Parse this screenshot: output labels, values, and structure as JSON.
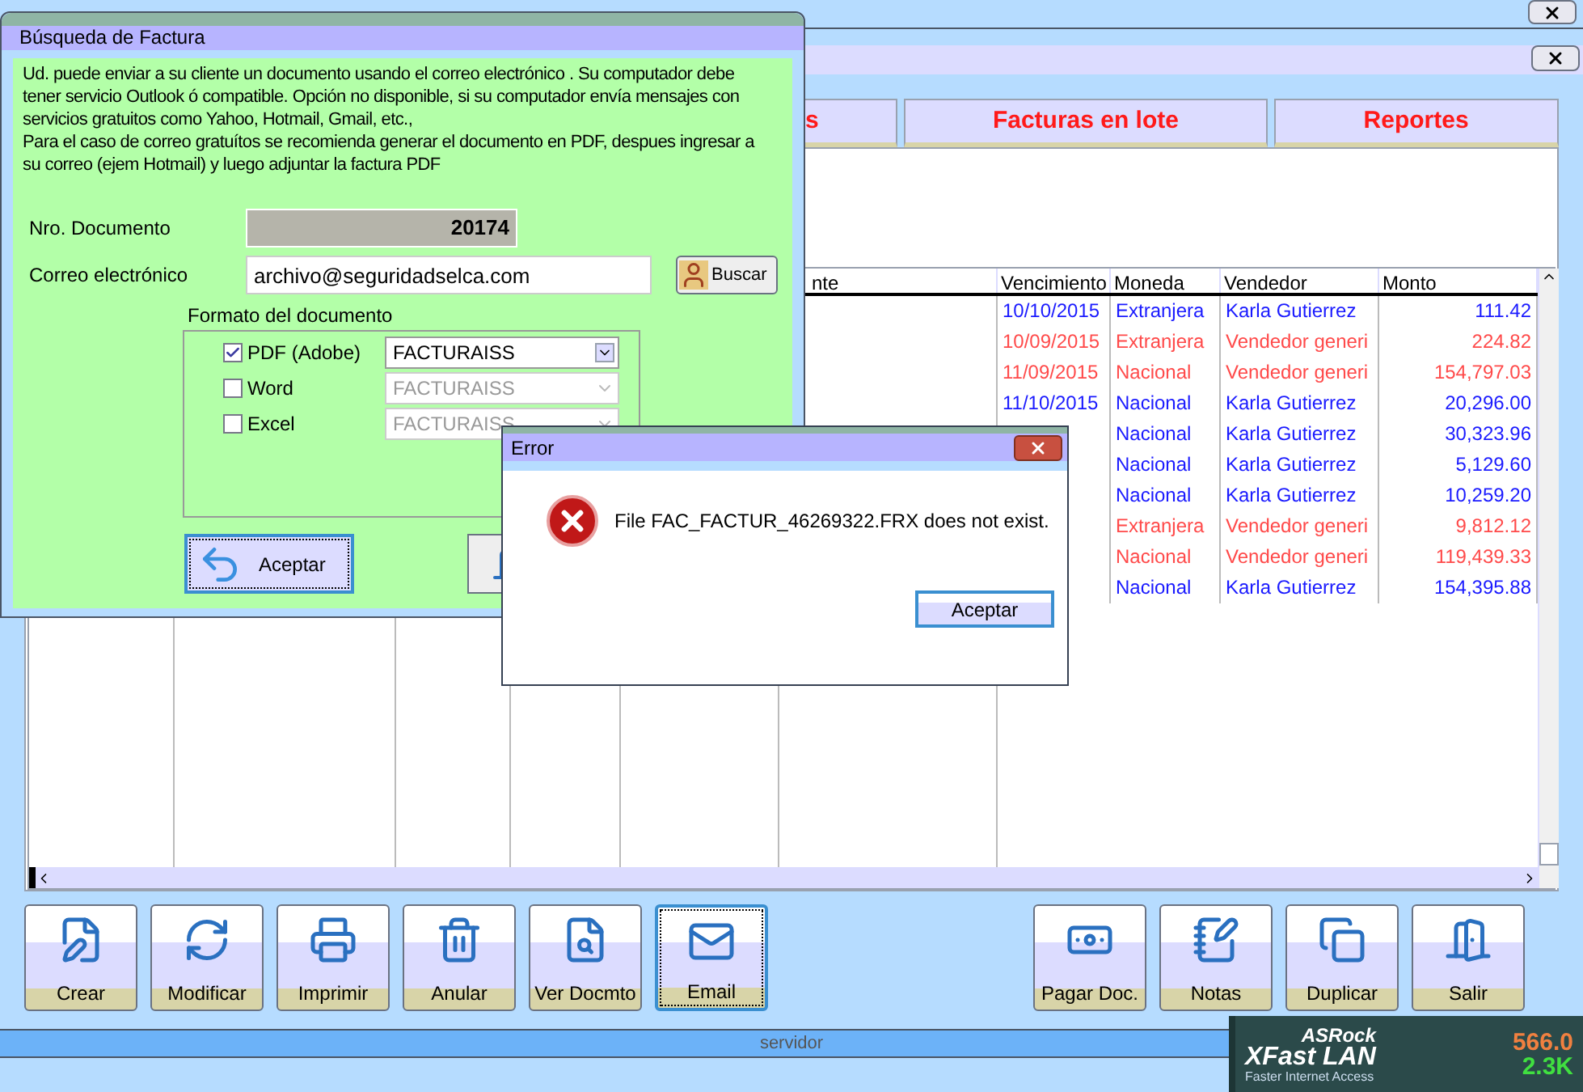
{
  "tabs": [
    {
      "label": "s",
      "selected": false
    },
    {
      "label": "Facturas en lote",
      "selected": false
    },
    {
      "label": "Reportes",
      "selected": false
    }
  ],
  "table": {
    "columns": [
      "nte",
      "Vencimiento",
      "Moneda",
      "Vendedor",
      "Monto"
    ],
    "rows": [
      {
        "color": "#1a1aff",
        "vencimiento": "10/10/2015",
        "moneda": "Extranjera",
        "vendedor": "Karla Gutierrez",
        "monto": "111.42"
      },
      {
        "color": "#ff4a4a",
        "vencimiento": "10/09/2015",
        "moneda": "Extranjera",
        "vendedor": "Vendedor generi",
        "monto": "224.82"
      },
      {
        "color": "#ff4a4a",
        "vencimiento": "11/09/2015",
        "moneda": "Nacional",
        "vendedor": "Vendedor generi",
        "monto": "154,797.03"
      },
      {
        "color": "#1a1aff",
        "vencimiento": "11/10/2015",
        "moneda": "Nacional",
        "vendedor": "Karla Gutierrez",
        "monto": "20,296.00"
      },
      {
        "color": "#1a1aff",
        "moneda": "Nacional",
        "vendedor": "Karla Gutierrez",
        "monto": "30,323.96"
      },
      {
        "color": "#1a1aff",
        "moneda": "Nacional",
        "vendedor": "Karla Gutierrez",
        "monto": "5,129.60"
      },
      {
        "color": "#1a1aff",
        "moneda": "Nacional",
        "vendedor": "Karla Gutierrez",
        "monto": "10,259.20"
      },
      {
        "color": "#ff4a4a",
        "moneda": "Extranjera",
        "vendedor": "Vendedor generi",
        "monto": "9,812.12"
      },
      {
        "color": "#ff4a4a",
        "moneda": "Nacional",
        "vendedor": "Vendedor generi",
        "monto": "119,439.33"
      },
      {
        "color": "#1a1aff",
        "moneda": "Nacional",
        "vendedor": "Karla Gutierrez",
        "monto": "154,395.88"
      }
    ]
  },
  "toolbar": [
    {
      "label": "Crear",
      "selected": false
    },
    {
      "label": "Modificar",
      "selected": false
    },
    {
      "label": "Imprimir",
      "selected": false
    },
    {
      "label": "Anular",
      "selected": false
    },
    {
      "label": "Ver Docmto",
      "selected": false
    },
    {
      "label": "Email",
      "selected": true
    },
    {
      "label": "Pagar Doc.",
      "selected": false
    },
    {
      "label": "Notas",
      "selected": false
    },
    {
      "label": "Duplicar",
      "selected": false
    },
    {
      "label": "Salir",
      "selected": false
    }
  ],
  "status_bar": {
    "text": "servidor"
  },
  "widget": {
    "brand": "ASRock",
    "product": "XFast LAN",
    "tagline": "Faster Internet Access",
    "readings": [
      "566.0",
      "2.3K"
    ]
  },
  "search_dialog": {
    "title": "Búsqueda de Factura",
    "info": "Ud. puede enviar a su cliente un documento usando el correo electrónico . Su computador debe tener servicio Outlook ó compatible.  Opción no disponible, si su computador envía mensajes  con servicios gratuitos como Yahoo, Hotmail,  Gmail, etc.,\nPara el caso de correo gratuítos se recomienda generar el documento en PDF, despues ingresar a su correo (ejem Hotmail) y luego adjuntar la factura PDF",
    "doc_label": "Nro. Documento",
    "doc_value": "20174",
    "email_label": "Correo electrónico",
    "email_value": "archivo@seguridadselca.com",
    "search_button": "Buscar",
    "format_title": "Formato del documento",
    "formats": [
      {
        "label": "PDF (Adobe)",
        "checked": true,
        "template": "FACTURAISS",
        "disabled": false
      },
      {
        "label": "Word",
        "checked": false,
        "template": "FACTURAISS",
        "disabled": true
      },
      {
        "label": "Excel",
        "checked": false,
        "template": "FACTURAISS",
        "disabled": true
      }
    ],
    "accept_button": "Aceptar"
  },
  "error_dialog": {
    "title": "Error",
    "message": "File FAC_FACTUR_46269322.FRX does not exist.",
    "button": "Aceptar"
  }
}
